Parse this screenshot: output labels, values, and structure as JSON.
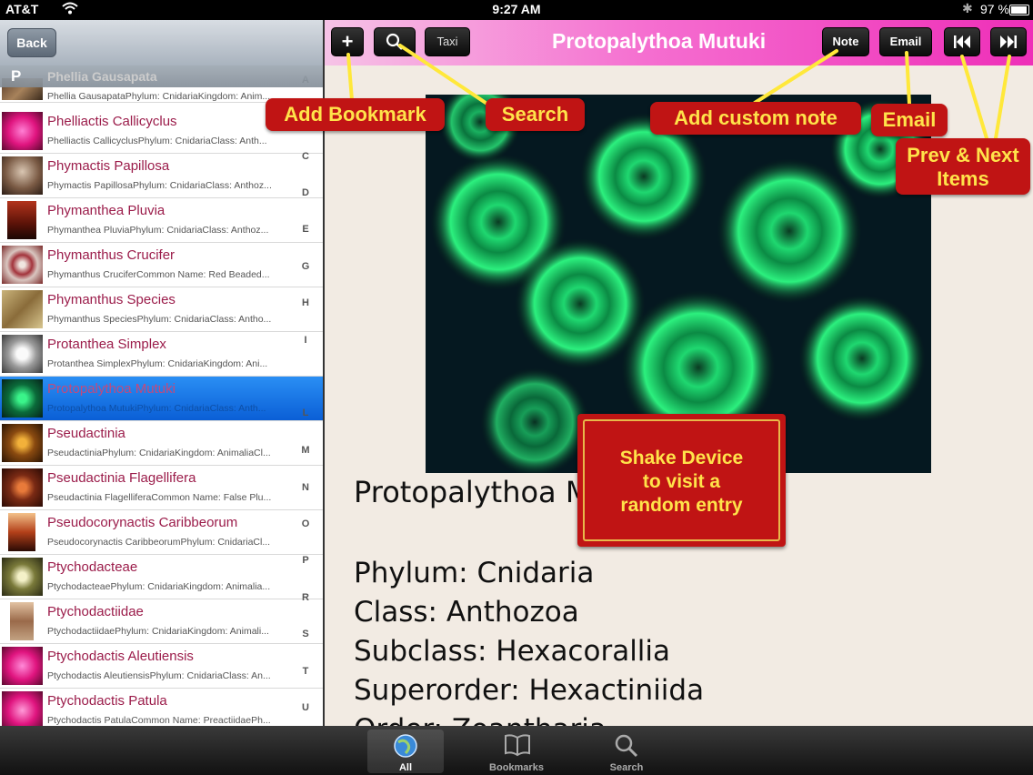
{
  "status_bar": {
    "carrier": "AT&T",
    "time": "9:27 AM",
    "battery": "97 %"
  },
  "left_nav": {
    "back_label": "Back"
  },
  "section": {
    "letter": "P",
    "ghost_title": "Phellia Gausapata"
  },
  "list": [
    {
      "title": "",
      "sub": "Phellia GausapataPhylum: CnidariaKingdom: Anim..."
    },
    {
      "title": "Phelliactis Callicyclus",
      "sub": "Phelliactis CallicyclusPhylum: CnidariaClass: Anth..."
    },
    {
      "title": "Phymactis Papillosa",
      "sub": "Phymactis PapillosaPhylum: CnidariaClass: Anthoz..."
    },
    {
      "title": "Phymanthea Pluvia",
      "sub": "Phymanthea PluviaPhylum: CnidariaClass: Anthoz..."
    },
    {
      "title": "Phymanthus Crucifer",
      "sub": "Phymanthus CruciferCommon Name: Red Beaded..."
    },
    {
      "title": "Phymanthus Species",
      "sub": "Phymanthus SpeciesPhylum: CnidariaClass: Antho..."
    },
    {
      "title": "Protanthea Simplex",
      "sub": "Protanthea SimplexPhylum: CnidariaKingdom: Ani..."
    },
    {
      "title": "Protopalythoa Mutuki",
      "sub": "Protopalythoa MutukiPhylum: CnidariaClass: Anth..."
    },
    {
      "title": "Pseudactinia",
      "sub": "PseudactiniaPhylum: CnidariaKingdom: AnimaliaCl..."
    },
    {
      "title": "Pseudactinia Flagellifera",
      "sub": "Pseudactinia FlagelliferaCommon Name: False Plu..."
    },
    {
      "title": "Pseudocorynactis Caribbeorum",
      "sub": "Pseudocorynactis CaribbeorumPhylum: CnidariaCl..."
    },
    {
      "title": "Ptychodacteae",
      "sub": "PtychodacteaePhylum: CnidariaKingdom: Animalia..."
    },
    {
      "title": "Ptychodactiidae",
      "sub": "PtychodactiidaePhylum: CnidariaKingdom: Animali..."
    },
    {
      "title": "Ptychodactis Aleutiensis",
      "sub": "Ptychodactis AleutiensisPhylum: CnidariaClass: An..."
    },
    {
      "title": "Ptychodactis Patula",
      "sub": "Ptychodactis PatulaCommon Name: PreactiidaePh..."
    }
  ],
  "index_letters": [
    "A",
    "C",
    "D",
    "E",
    "G",
    "H",
    "I",
    "L",
    "M",
    "N",
    "O",
    "P",
    "R",
    "S",
    "T",
    "U"
  ],
  "toolbar": {
    "add_label": "+",
    "taxi_label": "Taxi",
    "title": "Protopalythoa Mutuki",
    "note_label": "Note",
    "email_label": "Email"
  },
  "detail": {
    "heading": "Protopalythoa Mutuki",
    "taxonomy": [
      "Phylum: Cnidaria",
      "Class: Anthozoa",
      "Subclass: Hexacorallia",
      "Superorder: Hexactiniida",
      "Order: Zoantharia"
    ]
  },
  "annotations": {
    "add_bookmark": "Add Bookmark",
    "search": "Search",
    "add_note": "Add custom note",
    "email": "Email",
    "prev_next_1": "Prev & Next",
    "prev_next_2": "Items",
    "shake_1": "Shake Device",
    "shake_2": "to visit a",
    "shake_3": "random entry"
  },
  "tabbar": {
    "all": "All",
    "bookmarks": "Bookmarks",
    "search": "Search"
  },
  "colors": {
    "accent_pink": "#ee2fb8",
    "title_red": "#9b1c4a",
    "callout_red": "#c01414",
    "callout_text": "#ffe34a"
  }
}
